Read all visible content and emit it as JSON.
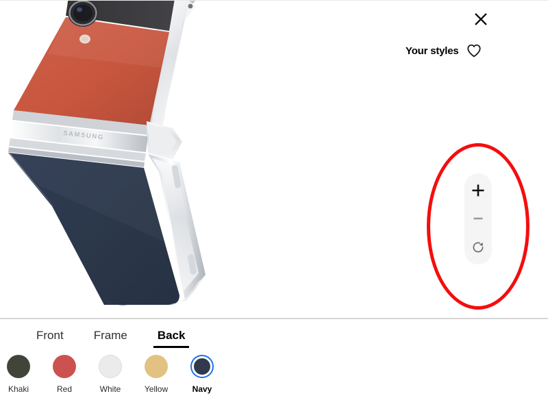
{
  "header": {
    "close_icon": "close-icon",
    "styles_label": "Your styles",
    "favorite_icon": "heart-icon"
  },
  "viewer": {
    "product_brand": "SAMSUNG",
    "product_alt": "Samsung Galaxy Z Flip partially folded, red back panel and navy lower panel",
    "colors": {
      "back_panel": "#c8563e",
      "camera_strip": "#3c3c3e",
      "lower_panel": "#2c3950",
      "frame": "#e4e6e8"
    }
  },
  "zoom_controls": {
    "zoom_in_label": "+",
    "zoom_out_label": "−",
    "reset_icon": "rotate-reset-icon"
  },
  "annotation": {
    "shape": "ellipse",
    "color": "#f50d0d"
  },
  "bottom": {
    "tabs": [
      {
        "label": "Front",
        "active": false
      },
      {
        "label": "Frame",
        "active": false
      },
      {
        "label": "Back",
        "active": true
      }
    ],
    "swatches": [
      {
        "label": "Khaki",
        "color": "#414539",
        "selected": false
      },
      {
        "label": "Red",
        "color": "#cb5250",
        "selected": false
      },
      {
        "label": "White",
        "color": "#ebebeb",
        "selected": false
      },
      {
        "label": "Yellow",
        "color": "#e2c183",
        "selected": false
      },
      {
        "label": "Navy",
        "color": "#303a4c",
        "selected": true
      }
    ],
    "selection_ring_color": "#1b72e8"
  }
}
